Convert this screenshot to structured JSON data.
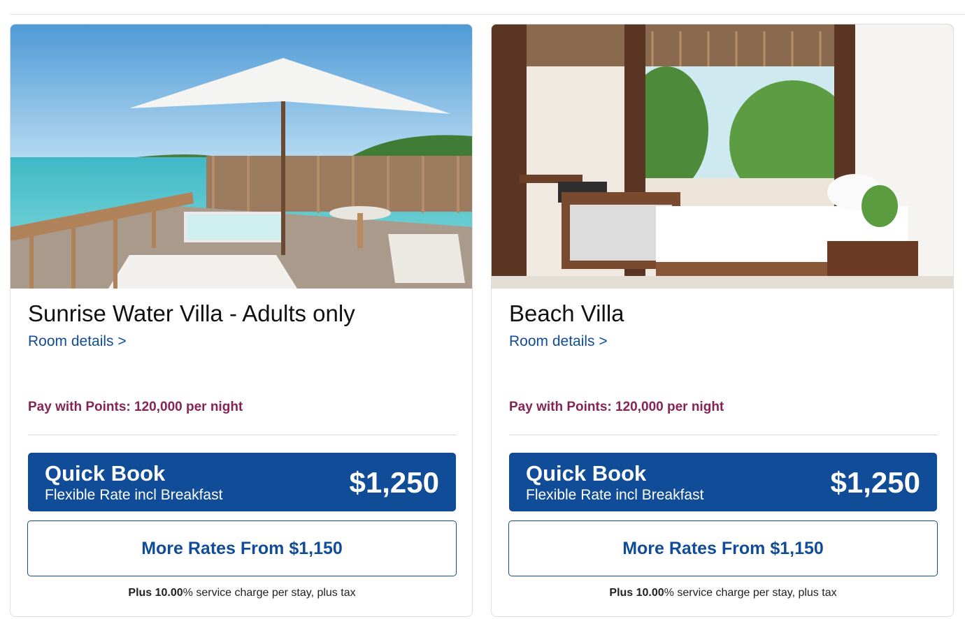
{
  "rooms": [
    {
      "title": "Sunrise Water Villa - Adults only",
      "image_alt": "Sunrise Water Villa deck with umbrella and lagoon",
      "details_link": "Room details >",
      "points_text": "Pay with Points: 120,000 per night",
      "quick_book": {
        "label": "Quick Book",
        "rate_name": "Flexible Rate incl Breakfast",
        "price": "$1,250"
      },
      "more_rates": "More Rates From $1,150",
      "fee_prefix": "Plus 10.00",
      "fee_suffix": "% service charge per stay, plus tax"
    },
    {
      "title": "Beach Villa",
      "image_alt": "Beach Villa bedroom opening to garden and beach",
      "details_link": "Room details >",
      "points_text": "Pay with Points: 120,000 per night",
      "quick_book": {
        "label": "Quick Book",
        "rate_name": "Flexible Rate incl Breakfast",
        "price": "$1,250"
      },
      "more_rates": "More Rates From $1,150",
      "fee_prefix": "Plus 10.00",
      "fee_suffix": "% service charge per stay, plus tax"
    }
  ],
  "colors": {
    "brand_blue": "#104c97",
    "points_magenta": "#862457"
  }
}
